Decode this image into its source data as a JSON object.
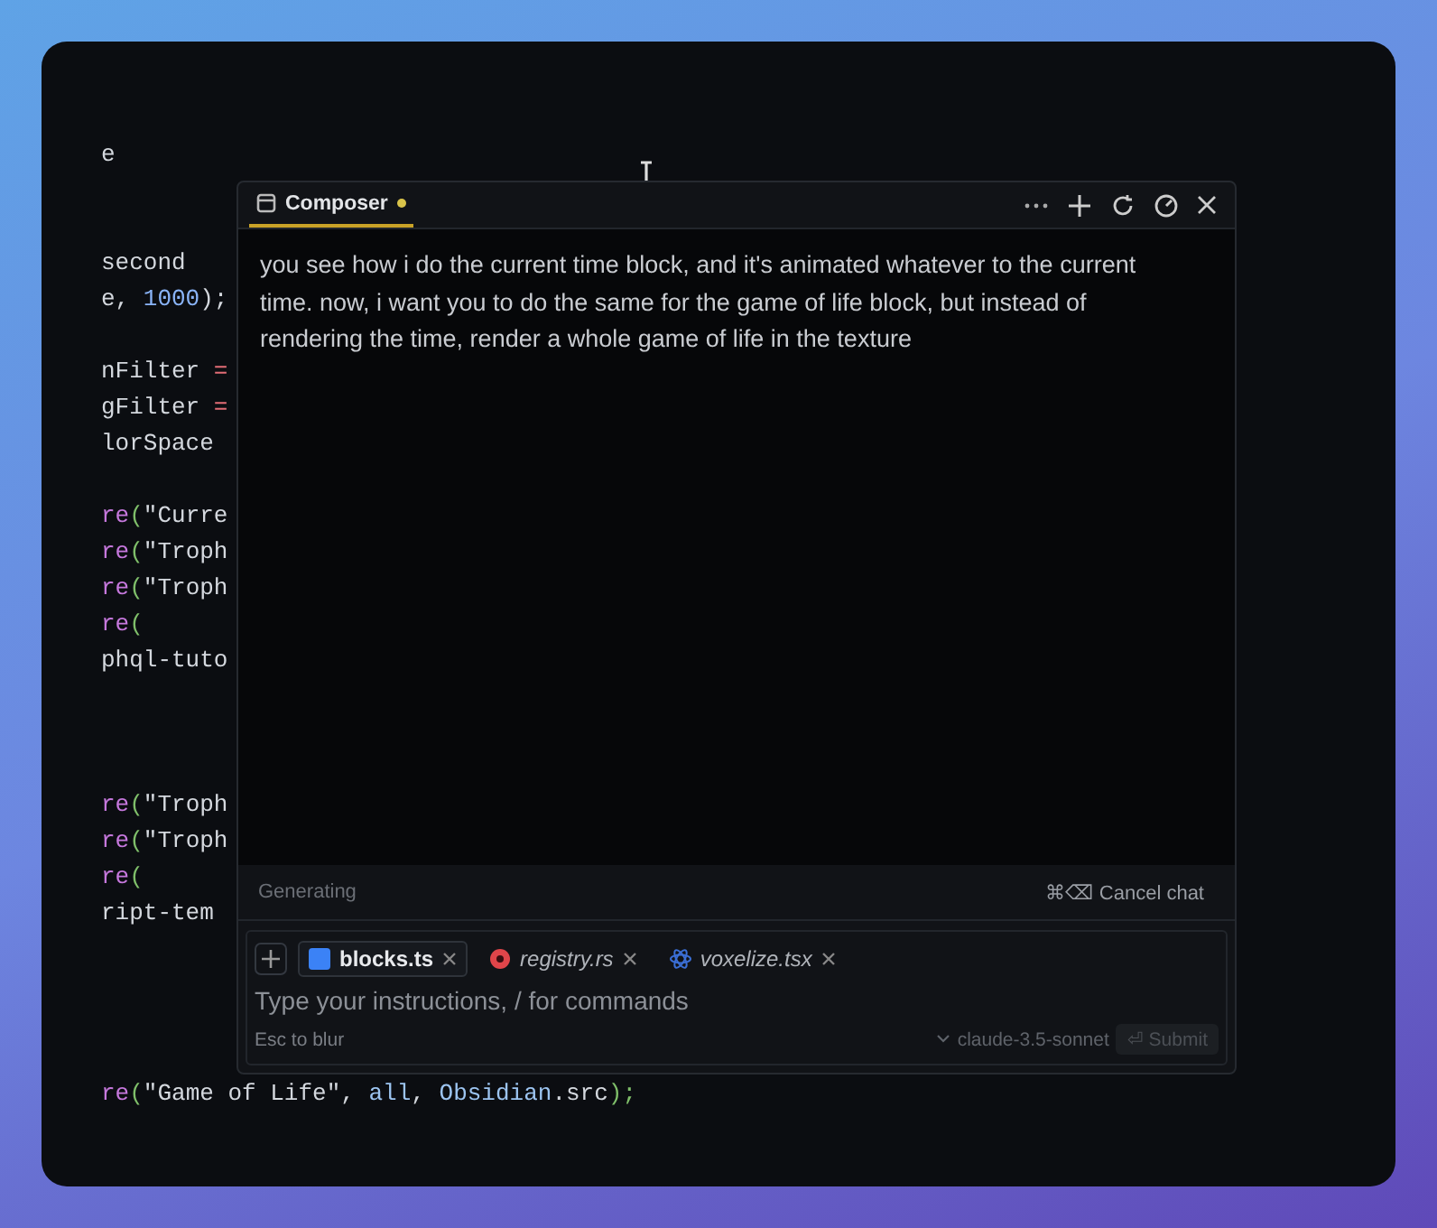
{
  "editor": {
    "lines": [
      {
        "kind": "code",
        "tokens": [
          {
            "text": "e",
            "kind": "plain"
          }
        ]
      },
      {
        "kind": "blank"
      },
      {
        "kind": "blank"
      },
      {
        "kind": "code",
        "tokens": [
          {
            "text": "second",
            "kind": "plain"
          }
        ]
      },
      {
        "kind": "code",
        "tokens": [
          {
            "text": "e, ",
            "kind": "plain"
          },
          {
            "text": "1000",
            "kind": "number"
          },
          {
            "text": ");",
            "kind": "plain"
          }
        ]
      },
      {
        "kind": "blank"
      },
      {
        "kind": "code",
        "tokens": [
          {
            "text": "nFilter ",
            "kind": "plain"
          },
          {
            "text": "=",
            "kind": "op"
          }
        ]
      },
      {
        "kind": "code",
        "tokens": [
          {
            "text": "gFilter ",
            "kind": "plain"
          },
          {
            "text": "=",
            "kind": "op"
          }
        ]
      },
      {
        "kind": "code",
        "tokens": [
          {
            "text": "lorSpace",
            "kind": "plain"
          }
        ]
      },
      {
        "kind": "blank"
      },
      {
        "kind": "code",
        "tokens": [
          {
            "text": "re",
            "kind": "func"
          },
          {
            "text": "(",
            "kind": "punct"
          },
          {
            "text": "\"Curre",
            "kind": "plain"
          }
        ]
      },
      {
        "kind": "code",
        "tokens": [
          {
            "text": "re",
            "kind": "func"
          },
          {
            "text": "(",
            "kind": "punct"
          },
          {
            "text": "\"Troph",
            "kind": "plain"
          }
        ]
      },
      {
        "kind": "code",
        "tokens": [
          {
            "text": "re",
            "kind": "func"
          },
          {
            "text": "(",
            "kind": "punct"
          },
          {
            "text": "\"Troph",
            "kind": "plain"
          }
        ]
      },
      {
        "kind": "code",
        "tokens": [
          {
            "text": "re",
            "kind": "func"
          },
          {
            "text": "(",
            "kind": "punct"
          }
        ]
      },
      {
        "kind": "code",
        "tokens": [
          {
            "text": "phql-tuto",
            "kind": "plain"
          }
        ]
      },
      {
        "kind": "blank"
      },
      {
        "kind": "blank"
      },
      {
        "kind": "blank"
      },
      {
        "kind": "code",
        "tokens": [
          {
            "text": "re",
            "kind": "func"
          },
          {
            "text": "(",
            "kind": "punct"
          },
          {
            "text": "\"Troph",
            "kind": "plain"
          }
        ]
      },
      {
        "kind": "code",
        "tokens": [
          {
            "text": "re",
            "kind": "func"
          },
          {
            "text": "(",
            "kind": "punct"
          },
          {
            "text": "\"Troph",
            "kind": "plain"
          }
        ]
      },
      {
        "kind": "code",
        "tokens": [
          {
            "text": "re",
            "kind": "func"
          },
          {
            "text": "(",
            "kind": "punct"
          }
        ]
      },
      {
        "kind": "code",
        "tokens": [
          {
            "text": "ript-tem",
            "kind": "plain"
          }
        ]
      },
      {
        "kind": "blank"
      },
      {
        "kind": "blank"
      },
      {
        "kind": "blank"
      },
      {
        "kind": "blank"
      },
      {
        "kind": "code",
        "tokens": [
          {
            "text": "re",
            "kind": "func"
          },
          {
            "text": "(",
            "kind": "punct"
          },
          {
            "text": "\"Game of Life\", ",
            "kind": "plain"
          },
          {
            "text": "all",
            "kind": "ident"
          },
          {
            "text": ", ",
            "kind": "plain"
          },
          {
            "text": "Obsidian",
            "kind": "ident"
          },
          {
            "text": ".src",
            "kind": "plain"
          },
          {
            "text": ");",
            "kind": "punct"
          }
        ]
      }
    ]
  },
  "composer": {
    "tab": {
      "label": "Composer",
      "unsaved": true,
      "selected": true
    },
    "message": "you see how i do the current time block, and it's animated whatever to the current time. now, i want you to do the same for the game of life block, but instead of rendering the time, render a whole game of life in the texture",
    "status": "Generating",
    "cancel": {
      "shortcut": "⌘⌫",
      "label": "Cancel chat"
    },
    "context_files": [
      {
        "name": "blocks.ts",
        "kind": "ts",
        "color": "#3b82f6",
        "selected": true
      },
      {
        "name": "registry.rs",
        "kind": "rust",
        "color": "#e0454a",
        "selected": false
      },
      {
        "name": "voxelize.tsx",
        "kind": "react",
        "color": "#3b6fd6",
        "selected": false
      }
    ],
    "input": {
      "placeholder": "Type your instructions, / for commands"
    },
    "hint": "Esc to blur",
    "model": "claude-3.5-sonnet",
    "submit": {
      "shortcut": "⏎",
      "label": "Submit",
      "disabled": true
    }
  }
}
